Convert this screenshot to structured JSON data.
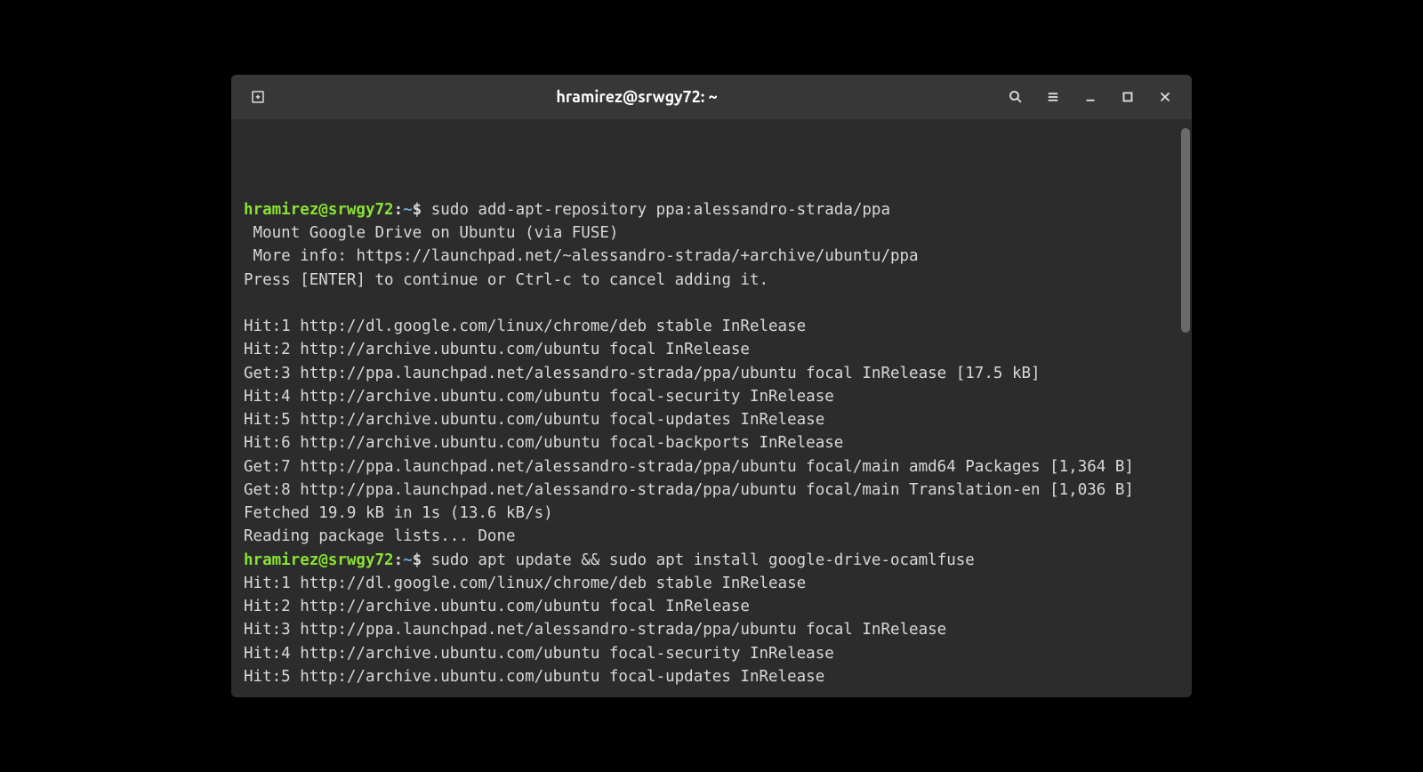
{
  "titlebar": {
    "title": "hramirez@srwgy72: ~"
  },
  "prompt": {
    "user_host": "hramirez@srwgy72",
    "sep": ":",
    "path": "~",
    "dollar": "$"
  },
  "session": [
    {
      "command": "sudo add-apt-repository ppa:alessandro-strada/ppa",
      "output": [
        " Mount Google Drive on Ubuntu (via FUSE)",
        " More info: https://launchpad.net/~alessandro-strada/+archive/ubuntu/ppa",
        "Press [ENTER] to continue or Ctrl-c to cancel adding it.",
        "",
        "Hit:1 http://dl.google.com/linux/chrome/deb stable InRelease",
        "Hit:2 http://archive.ubuntu.com/ubuntu focal InRelease",
        "Get:3 http://ppa.launchpad.net/alessandro-strada/ppa/ubuntu focal InRelease [17.5 kB]",
        "Hit:4 http://archive.ubuntu.com/ubuntu focal-security InRelease",
        "Hit:5 http://archive.ubuntu.com/ubuntu focal-updates InRelease",
        "Hit:6 http://archive.ubuntu.com/ubuntu focal-backports InRelease",
        "Get:7 http://ppa.launchpad.net/alessandro-strada/ppa/ubuntu focal/main amd64 Packages [1,364 B]",
        "Get:8 http://ppa.launchpad.net/alessandro-strada/ppa/ubuntu focal/main Translation-en [1,036 B]",
        "Fetched 19.9 kB in 1s (13.6 kB/s)",
        "Reading package lists... Done"
      ]
    },
    {
      "command": "sudo apt update && sudo apt install google-drive-ocamlfuse",
      "output": [
        "Hit:1 http://dl.google.com/linux/chrome/deb stable InRelease",
        "Hit:2 http://archive.ubuntu.com/ubuntu focal InRelease",
        "Hit:3 http://ppa.launchpad.net/alessandro-strada/ppa/ubuntu focal InRelease",
        "Hit:4 http://archive.ubuntu.com/ubuntu focal-security InRelease",
        "Hit:5 http://archive.ubuntu.com/ubuntu focal-updates InRelease"
      ]
    }
  ]
}
